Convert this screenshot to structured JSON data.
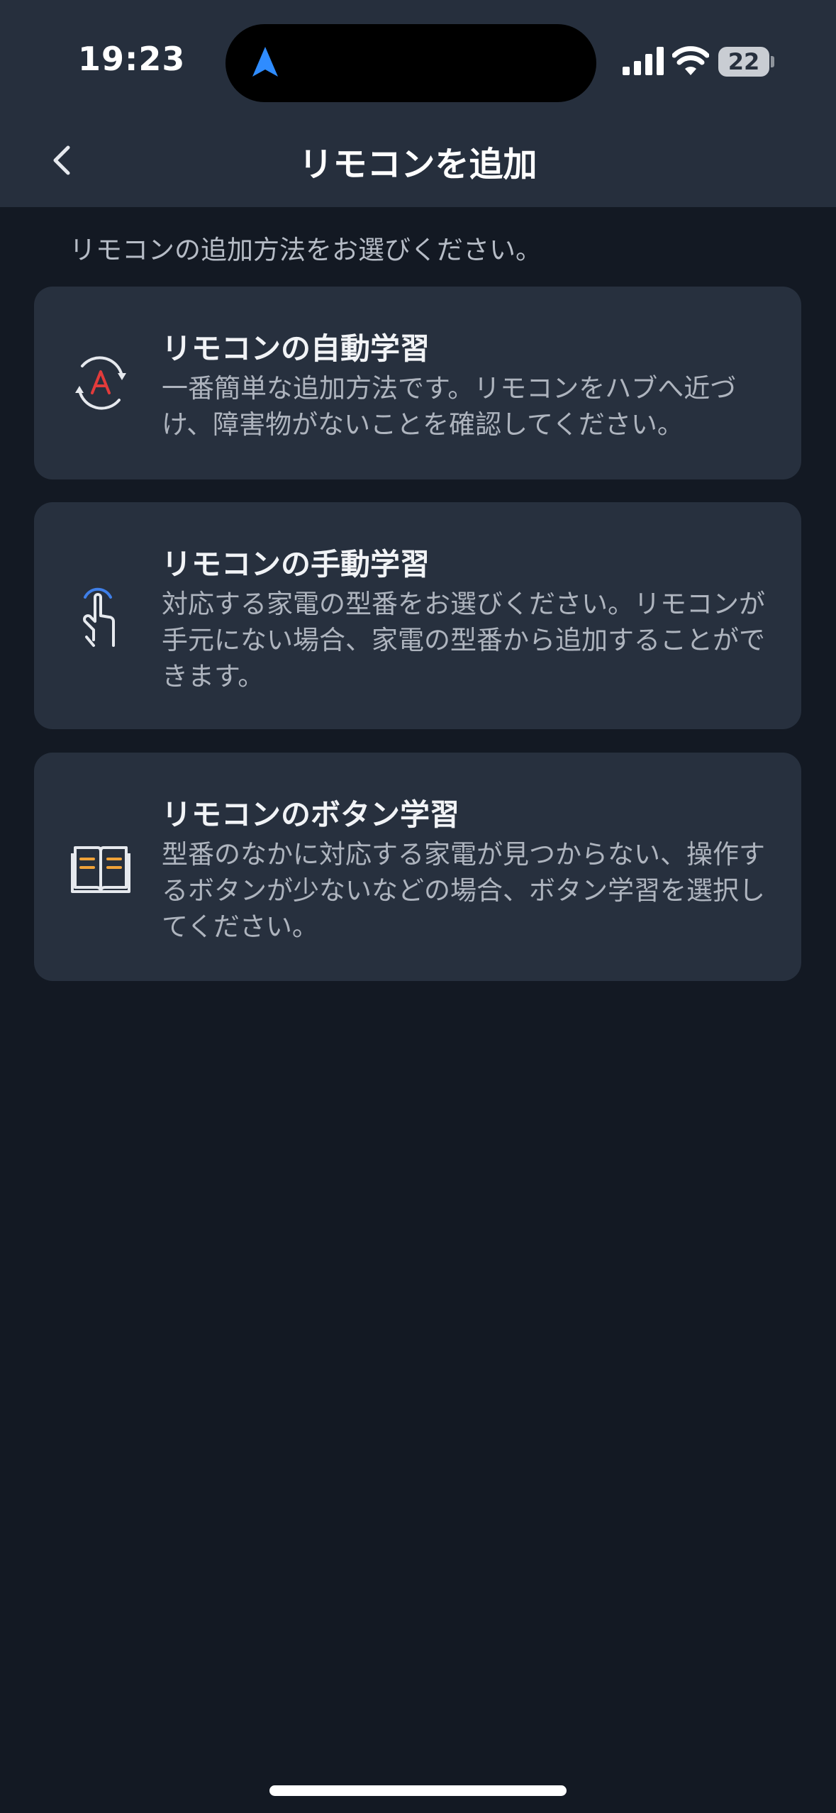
{
  "status_bar": {
    "time": "19:23",
    "battery": "22"
  },
  "header": {
    "title": "リモコンを追加"
  },
  "instruction": "リモコンの追加方法をお選びください。",
  "options": [
    {
      "title": "リモコンの自動学習",
      "description": "一番簡単な追加方法です。リモコンをハブへ近づけ、障害物がないことを確認してください。"
    },
    {
      "title": "リモコンの手動学習",
      "description": "対応する家電の型番をお選びください。リモコンが手元にない場合、家電の型番から追加することができます。"
    },
    {
      "title": "リモコンのボタン学習",
      "description": "型番のなかに対応する家電が見つからない、操作するボタンが少ないなどの場合、ボタン学習を選択してください。"
    }
  ],
  "colors": {
    "background": "#131923",
    "header_background": "#262f3d",
    "card_background": "#27303e",
    "auto_icon_accent": "#e23b3b",
    "manual_icon_accent": "#3f7fe8",
    "button_icon_accent": "#f0a238",
    "location_arrow": "#2f8cff"
  },
  "icons": {
    "location": "location-arrow-icon",
    "back": "chevron-left-icon",
    "auto": "refresh-a-icon",
    "manual": "tap-hand-icon",
    "button": "open-book-icon"
  }
}
